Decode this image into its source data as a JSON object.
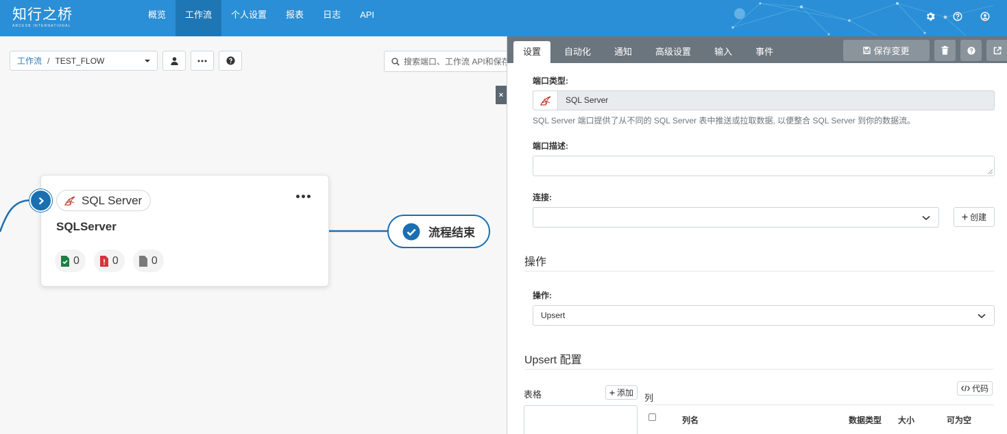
{
  "brand": {
    "name": "知行之桥",
    "tagline": "ARCESB INTERNATIONAL"
  },
  "nav": {
    "items": [
      {
        "label": "概览",
        "active": false
      },
      {
        "label": "工作流",
        "active": true
      },
      {
        "label": "个人设置",
        "active": false
      },
      {
        "label": "报表",
        "active": false
      },
      {
        "label": "日志",
        "active": false
      },
      {
        "label": "API",
        "active": false
      }
    ],
    "icons": [
      "gear-icon",
      "help-icon",
      "user-icon"
    ]
  },
  "toolbar": {
    "breadcrumb_root": "工作流",
    "breadcrumb_sep": "/",
    "flow_name": "TEST_FLOW",
    "search_placeholder": "搜索端口、工作流 API和保存"
  },
  "node": {
    "type_label": "SQL Server",
    "title": "SQLServer",
    "stats": [
      {
        "icon": "file-success-icon",
        "count": "0",
        "color": "#1e7e44"
      },
      {
        "icon": "file-error-icon",
        "count": "0",
        "color": "#d9333f"
      },
      {
        "icon": "file-pending-icon",
        "count": "0",
        "color": "#7a7a7a"
      }
    ]
  },
  "end_node": {
    "label": "流程结束"
  },
  "close_tab": {
    "label": "×"
  },
  "panel": {
    "tabs": [
      {
        "label": "设置",
        "active": true
      },
      {
        "label": "自动化",
        "active": false
      },
      {
        "label": "通知",
        "active": false
      },
      {
        "label": "高级设置",
        "active": false
      },
      {
        "label": "输入",
        "active": false
      },
      {
        "label": "事件",
        "active": false
      }
    ],
    "save_label": "保存变更",
    "port_type_label": "端口类型:",
    "port_type_value": "SQL Server",
    "port_type_help": "SQL Server 端口提供了从不同的 SQL Server 表中推送或拉取数据, 以便整合 SQL Server 到你的数据流。",
    "desc_label": "端口描述:",
    "desc_value": "",
    "conn_label": "连接:",
    "conn_value": "",
    "create_label": "创建",
    "ops_section": "操作",
    "op_label": "操作:",
    "op_value": "Upsert",
    "upsert_section": "Upsert 配置",
    "tables_label": "表格",
    "add_label": "添加",
    "columns_label": "列",
    "code_label": "代码",
    "col_headers": [
      "列名",
      "数据类型",
      "大小",
      "可为空"
    ]
  },
  "colors": {
    "nav_bg": "#2a8fd6",
    "nav_active": "#1f76b5",
    "panel_head": "#6b757d",
    "accent": "#1a6fb1"
  }
}
